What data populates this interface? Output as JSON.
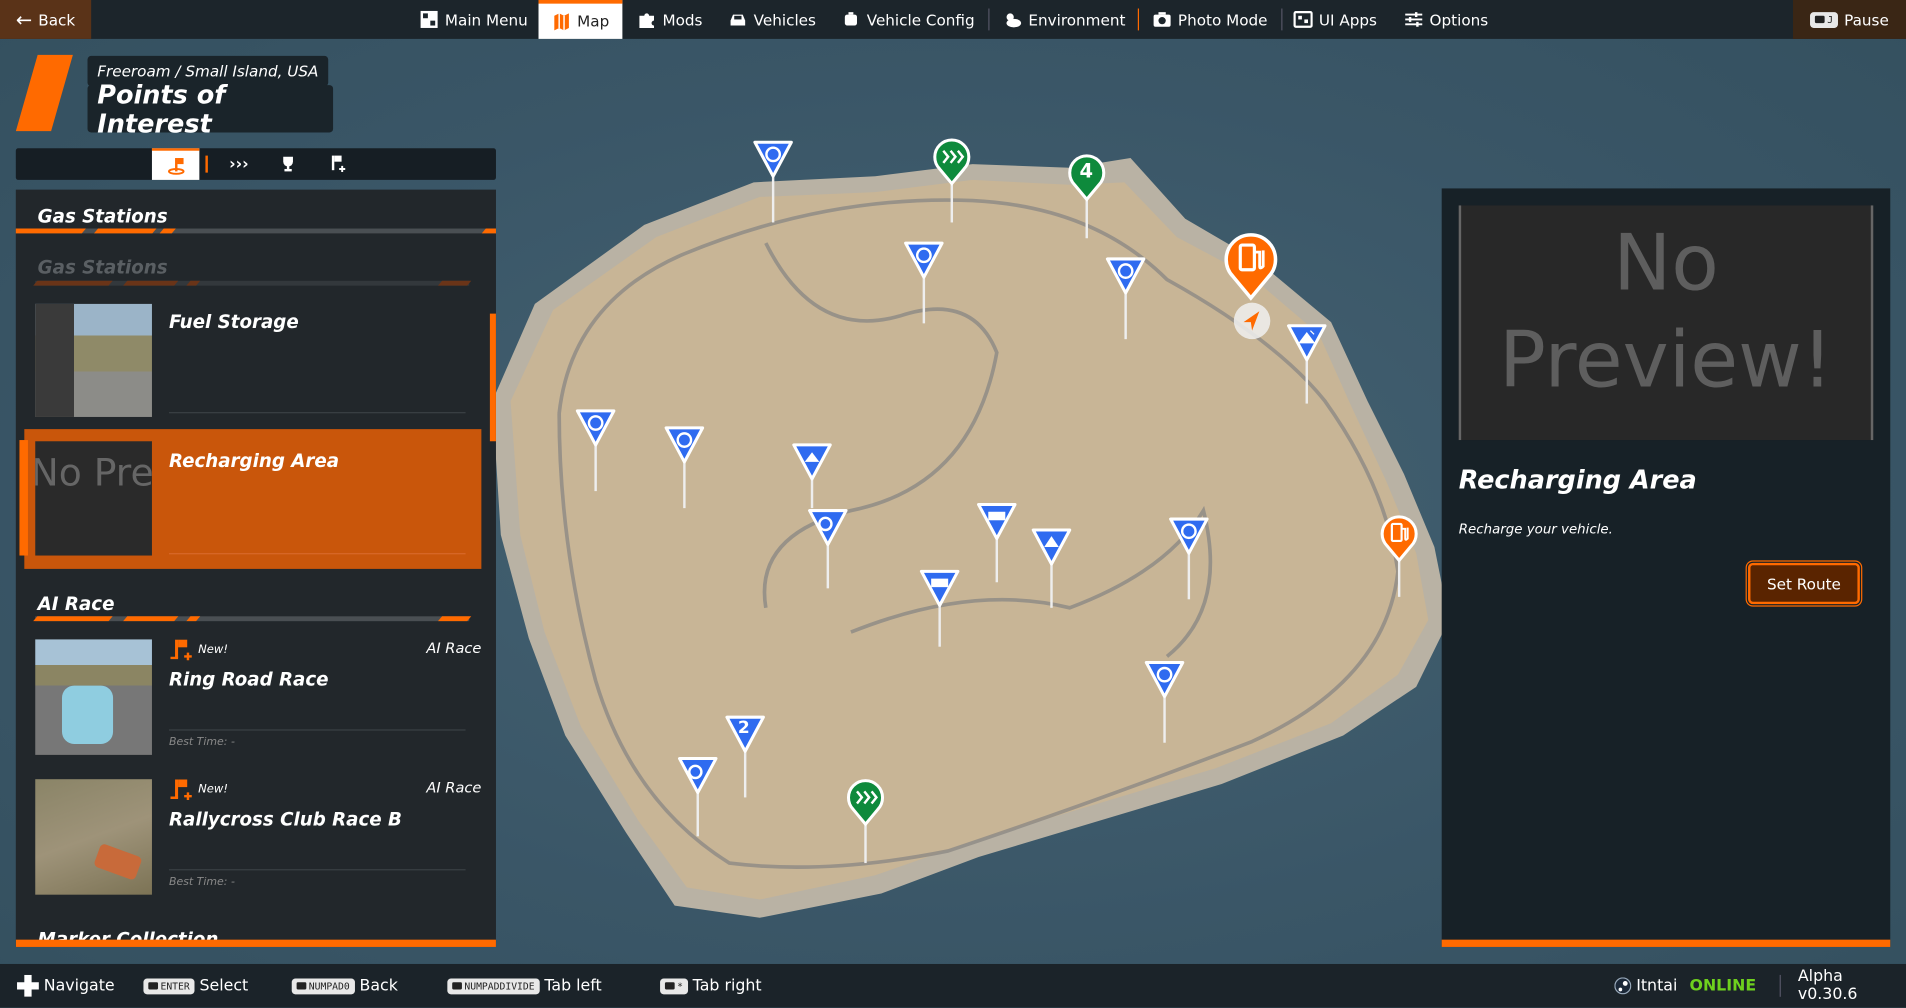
{
  "topbar": {
    "back": "Back",
    "items": [
      {
        "label": "Main Menu",
        "icon": "main-menu-icon"
      },
      {
        "label": "Map",
        "icon": "map-icon",
        "active": true
      },
      {
        "label": "Mods",
        "icon": "puzzle-icon"
      },
      {
        "label": "Vehicles",
        "icon": "car-icon"
      },
      {
        "label": "Vehicle Config",
        "icon": "engine-icon"
      },
      {
        "label": "Environment",
        "icon": "weather-icon"
      },
      {
        "label": "Photo Mode",
        "icon": "camera-icon"
      },
      {
        "label": "UI Apps",
        "icon": "apps-icon"
      },
      {
        "label": "Options",
        "icon": "sliders-icon"
      }
    ],
    "pause_key": "J",
    "pause": "Pause"
  },
  "header": {
    "breadcrumb": "Freeroam / Small Island, USA",
    "title": "Points of Interest"
  },
  "left_panel": {
    "section1": "Gas Stations",
    "subsection1": "Gas Stations",
    "items": [
      {
        "title": "Fuel Storage"
      },
      {
        "title": "Recharging Area",
        "selected": true,
        "thumb_text": "No Preview"
      }
    ],
    "section2": "AI Race",
    "races": [
      {
        "badge": "New!",
        "type": "AI Race",
        "title": "Ring Road Race",
        "best": "Best Time: -"
      },
      {
        "badge": "New!",
        "type": "AI Race",
        "title": "Rallycross Club Race B",
        "best": "Best Time: -"
      }
    ],
    "section3": "Marker Collection"
  },
  "detail": {
    "preview_l1": "No",
    "preview_l2": "Preview!",
    "title": "Recharging Area",
    "description": "Recharge your vehicle.",
    "button": "Set Route"
  },
  "map": {
    "marker_4": "4",
    "marker_2": "2"
  },
  "bottombar": {
    "navigate": "Navigate",
    "hints": [
      {
        "key": "ENTER",
        "label": "Select"
      },
      {
        "key": "NUMPAD0",
        "label": "Back"
      },
      {
        "key": "NUMPADDIVIDE",
        "label": "Tab left"
      },
      {
        "key": "*",
        "label": "Tab right"
      }
    ],
    "user": "Itntai",
    "status": "ONLINE",
    "version": "Alpha v0.30.6"
  },
  "colors": {
    "accent": "#ff6a00",
    "online": "#6ed11e",
    "marker_blue": "#2f6bf0",
    "marker_green": "#0e8a3c"
  }
}
